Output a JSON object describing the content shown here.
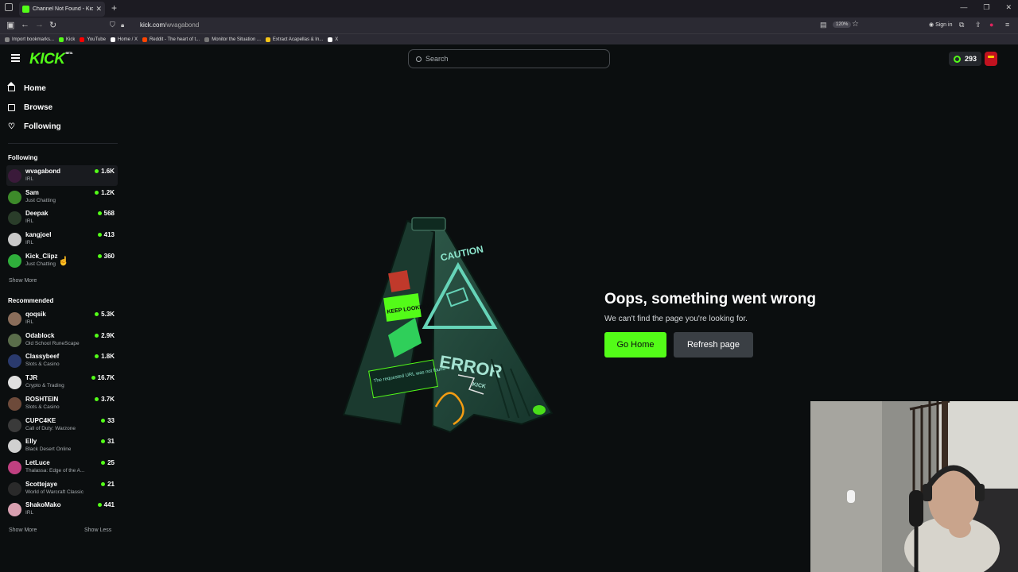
{
  "browser": {
    "tab_title": "Channel Not Found - Kick Strea...",
    "url_domain": "kick.com",
    "url_path": "/wvagabond",
    "zoom": "120%",
    "sign_in": "Sign in",
    "bookmarks": [
      {
        "label": "Import bookmarks...",
        "color": "#888888"
      },
      {
        "label": "Kick",
        "color": "#53fc18"
      },
      {
        "label": "YouTube",
        "color": "#ff0000"
      },
      {
        "label": "Home / X",
        "color": "#ffffff"
      },
      {
        "label": "Reddit - The heart of t...",
        "color": "#ff4500"
      },
      {
        "label": "Monitor the Situation ...",
        "color": "#777777"
      },
      {
        "label": "Extract Acapellas & In...",
        "color": "#f5c518"
      },
      {
        "label": "X",
        "color": "#ffffff"
      }
    ]
  },
  "header": {
    "logo": "KICK",
    "logo_badge": "BETA",
    "search_placeholder": "Search",
    "points": "293"
  },
  "sidebar": {
    "nav": [
      {
        "label": "Home",
        "icon": "home-icon"
      },
      {
        "label": "Browse",
        "icon": "browse-icon"
      },
      {
        "label": "Following",
        "icon": "heart-icon"
      }
    ],
    "following_heading": "Following",
    "following": [
      {
        "name": "wvagabond",
        "category": "IRL",
        "viewers": "1.6K",
        "avatar": "#3a1a3a"
      },
      {
        "name": "Sam",
        "category": "Just Chatting",
        "viewers": "1.2K",
        "avatar": "#3d8b2a"
      },
      {
        "name": "Deepak",
        "category": "IRL",
        "viewers": "568",
        "avatar": "#2a3d2a"
      },
      {
        "name": "kangjoel",
        "category": "IRL",
        "viewers": "413",
        "avatar": "#c9c9c9"
      },
      {
        "name": "Kick_Clipz",
        "category": "Just Chatting",
        "viewers": "360",
        "avatar": "#2fae3b"
      }
    ],
    "show_more_following": "Show More",
    "recommended_heading": "Recommended",
    "recommended": [
      {
        "name": "qoqsik",
        "category": "IRL",
        "viewers": "5.3K",
        "avatar": "#8a6d5a"
      },
      {
        "name": "Odablock",
        "category": "Old School RuneScape",
        "viewers": "2.9K",
        "avatar": "#5a6d4a"
      },
      {
        "name": "Classybeef",
        "category": "Slots & Casino",
        "viewers": "1.8K",
        "avatar": "#2a3a6d"
      },
      {
        "name": "TJR",
        "category": "Crypto & Trading",
        "viewers": "16.7K",
        "avatar": "#e0e0e0"
      },
      {
        "name": "ROSHTEIN",
        "category": "Slots & Casino",
        "viewers": "3.7K",
        "avatar": "#6d4a3a"
      },
      {
        "name": "CUPC4KE",
        "category": "Call of Duty: Warzone",
        "viewers": "33",
        "avatar": "#3a3a3a"
      },
      {
        "name": "Elly",
        "category": "Black Desert Online",
        "viewers": "31",
        "avatar": "#d0d0d0"
      },
      {
        "name": "LetLuce",
        "category": "Thalassa: Edge of the A...",
        "viewers": "25",
        "avatar": "#c04080"
      },
      {
        "name": "Scottejaye",
        "category": "World of Warcraft Classic",
        "viewers": "21",
        "avatar": "#2a2a2a"
      },
      {
        "name": "ShakoMako",
        "category": "IRL",
        "viewers": "441",
        "avatar": "#d8a0b0"
      }
    ],
    "show_more_recommended": "Show More",
    "show_less_recommended": "Show Less"
  },
  "main": {
    "error_title": "Oops, something went wrong",
    "error_subtitle": "We can't find the page you're looking for.",
    "go_home": "Go Home",
    "refresh": "Refresh page",
    "sign_caution": "CAUTION",
    "sign_error": "ERROR",
    "sign_kick": "KICK",
    "sign_keep": "KEEP LOOKING",
    "sign_notfound": "The requested URL was not found"
  },
  "colors": {
    "accent": "#53fc18",
    "background": "#0b0e0f"
  }
}
